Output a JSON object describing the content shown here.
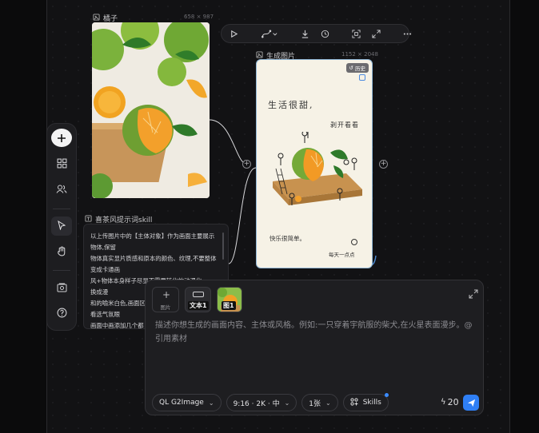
{
  "canvas": {
    "node_orange": {
      "title": "橘子",
      "dims": "658 × 987"
    },
    "node_generated": {
      "title": "生成图片",
      "dims": "1152 × 2048",
      "history_badge": "历史"
    },
    "node_skill": {
      "title": "喜茶风提示词skill",
      "lines": [
        "以上传图片中的【主体对象】作为画面主要展示",
        "物体,保留",
        "物体真实显片质感和原本的颜色、纹理,不要整体",
        "变成卡通画",
        "风+物体本身样子尽显不需要转化的动漫化",
        "换成漫",
        "和的喻米白色,画面区",
        "看选气氛眼",
        "画面中画添加几个都"
      ]
    },
    "generated_handwriting": [
      "生活很甜,",
      "剥开看看",
      "快乐很简单。",
      "每天一点点"
    ]
  },
  "toolbar": {
    "items": [
      "add",
      "grid",
      "users",
      "select",
      "hand",
      "media",
      "help"
    ]
  },
  "top_tools": [
    "play",
    "curve",
    "download",
    "history",
    "scan",
    "expand",
    "more"
  ],
  "composer": {
    "image_tile_label": "图片",
    "ref_text_label": "文本1",
    "ref_image_label": "图1",
    "prompt_placeholder": "描述你想生成的画面内容、主体或风格。例如:一只穿着宇航服的柴犬,在火星表面漫步。@引用素材",
    "model": "QL G2Image",
    "ratio": "9:16 · 2K · 中",
    "count": "1张",
    "skills": "Skills",
    "credits": "20"
  },
  "colors": {
    "accent": "#2f7ff5",
    "background": "#121214",
    "panel": "#1e1e21"
  }
}
